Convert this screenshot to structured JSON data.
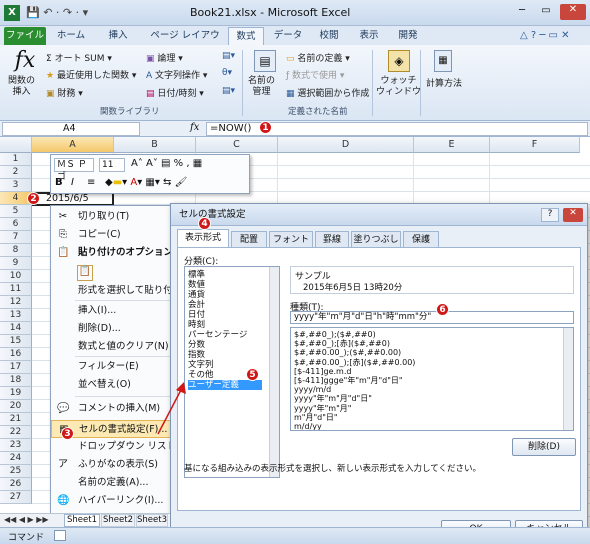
{
  "app": {
    "title": "Book21.xlsx - Microsoft Excel"
  },
  "tabs": [
    "ファイル",
    "ホーム",
    "挿入",
    "ページ レイアウト",
    "数式",
    "データ",
    "校閲",
    "表示",
    "開発"
  ],
  "ribbon": {
    "insert_fn": "関数の\n挿入",
    "autosum": "オート SUM",
    "recent": "最近使用した関数",
    "finance": "財務",
    "logic": "論理",
    "text": "文字列操作",
    "datetime": "日付/時刻",
    "name_mgr": "名前の\n管理",
    "define_name": "名前の定義",
    "use_in_formula": "数式で使用",
    "create_from_sel": "選択範囲から作成",
    "watch": "ウォッチ\nウィンドウ",
    "calc": "計算方法",
    "grp_fnlib": "関数ライブラリ",
    "grp_names": "定義された名前"
  },
  "formula_bar": {
    "name_box": "A4",
    "fx": "fx",
    "formula": "=NOW()"
  },
  "columns": [
    "A",
    "B",
    "C",
    "D",
    "E",
    "F"
  ],
  "rows": [
    "1",
    "2",
    "3",
    "4",
    "5",
    "6",
    "7",
    "8",
    "9",
    "10",
    "11",
    "12",
    "13",
    "14",
    "15",
    "16",
    "17",
    "18",
    "19",
    "20",
    "21",
    "22",
    "23",
    "24",
    "25",
    "26",
    "27"
  ],
  "cell_a4": "2015/6/5",
  "mini_toolbar": {
    "font": "ＭＳ Ｐゴ",
    "size": "11",
    "row2": [
      "B",
      "I",
      "≡"
    ]
  },
  "context_menu": [
    {
      "label": "切り取り(T)",
      "icon": "✂"
    },
    {
      "label": "コピー(C)",
      "icon": "⎘"
    },
    {
      "label": "貼り付けのオプション:",
      "icon": "📋",
      "bold": true
    },
    {
      "label": "",
      "icon": "📋",
      "spacer": true
    },
    {
      "label": "形式を選択して貼り付け(S)...",
      "icon": ""
    },
    {
      "label": "挿入(I)...",
      "icon": ""
    },
    {
      "label": "削除(D)...",
      "icon": ""
    },
    {
      "label": "数式と値のクリア(N)",
      "icon": ""
    },
    {
      "label": "フィルター(E)",
      "icon": ""
    },
    {
      "label": "並べ替え(O)",
      "icon": ""
    },
    {
      "label": "コメントの挿入(M)",
      "icon": "💬"
    },
    {
      "label": "セルの書式設定(F)...",
      "icon": "▦"
    },
    {
      "label": "ドロップダウン リストから選択(K)...",
      "icon": ""
    },
    {
      "label": "ふりがなの表示(S)",
      "icon": "ア"
    },
    {
      "label": "名前の定義(A)...",
      "icon": ""
    },
    {
      "label": "ハイパーリンク(I)...",
      "icon": "🌐"
    }
  ],
  "dialog": {
    "title": "セルの書式設定",
    "tabs": [
      "表示形式",
      "配置",
      "フォント",
      "罫線",
      "塗りつぶし",
      "保護"
    ],
    "category_label": "分類(C):",
    "categories": [
      "標準",
      "数値",
      "通貨",
      "会計",
      "日付",
      "時刻",
      "パーセンテージ",
      "分数",
      "指数",
      "文字列",
      "その他",
      "ユーザー定義"
    ],
    "selected_category": "ユーザー定義",
    "sample_label": "サンプル",
    "sample_value": "2015年6月5日 13時20分",
    "type_label": "種類(T):",
    "type_value": "yyyy\"年\"m\"月\"d\"日\"h\"時\"mm\"分\"",
    "formats": [
      "$#,##0_);($#,##0)",
      "$#,##0_);[赤]($#,##0)",
      "$#,##0.00_);($#,##0.00)",
      "$#,##0.00_);[赤]($#,##0.00)",
      "[$-411]ge.m.d",
      "[$-411]ggge\"年\"m\"月\"d\"日\"",
      "yyyy/m/d",
      "yyyy\"年\"m\"月\"d\"日\"",
      "yyyy\"年\"m\"月\"",
      "m\"月\"d\"日\"",
      "m/d/yy"
    ],
    "delete_btn": "削除(D)",
    "description": "基になる組み込みの表示形式を選択し、新しい表示形式を入力してください。",
    "ok": "OK",
    "cancel": "キャンセル"
  },
  "sheet_tabs": [
    "Sheet1",
    "Sheet2",
    "Sheet3"
  ],
  "status": "コマンド",
  "badges": [
    "1",
    "2",
    "3",
    "4",
    "5",
    "6"
  ]
}
